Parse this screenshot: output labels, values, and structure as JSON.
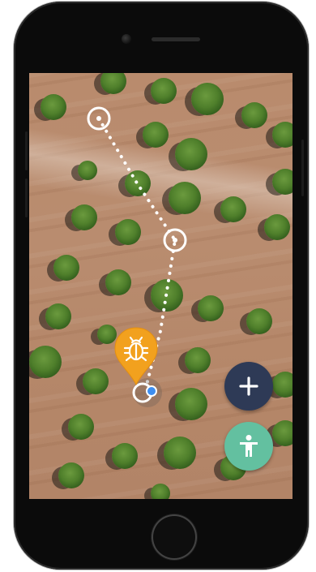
{
  "colors": {
    "field": "#b98b6d",
    "tree": "#4f7f2b",
    "route": "#ffffff",
    "pest_pin": "#f2a11e",
    "user_dot": "#3d8ef0",
    "add_button": "#2e3a56",
    "person_button": "#63c0a0"
  },
  "map": {
    "waypoints": [
      "waypoint-start",
      "waypoint-middle",
      "waypoint-current"
    ],
    "pest_marker": {
      "icon": "bug-icon"
    },
    "user_location": {
      "icon": "location-dot-icon"
    }
  },
  "actions": {
    "add": {
      "icon": "plus-icon",
      "label": "+"
    },
    "person": {
      "icon": "person-icon"
    }
  }
}
